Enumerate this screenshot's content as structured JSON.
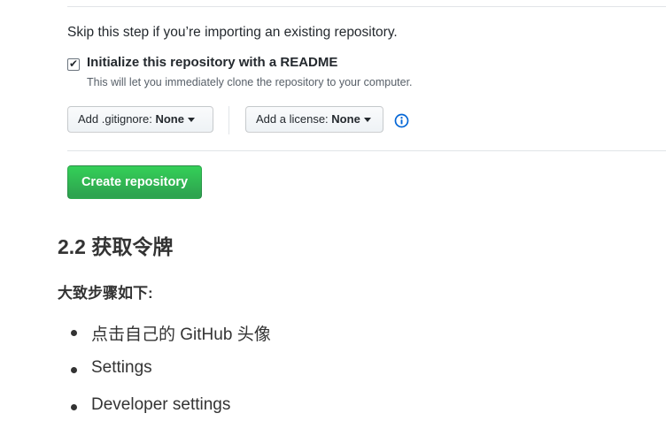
{
  "form": {
    "skip_text": "Skip this step if you’re importing an existing repository.",
    "readme": {
      "checked": true,
      "label": "Initialize this repository with a README",
      "description": "This will let you immediately clone the repository to your computer."
    },
    "gitignore": {
      "prefix": "Add .gitignore:",
      "value": "None"
    },
    "license": {
      "prefix": "Add a license:",
      "value": "None"
    },
    "info_icon": "info-circle-icon",
    "create_button": "Create repository",
    "colors": {
      "create_button": "#2ea44f",
      "info_icon": "#0366d6"
    }
  },
  "doc": {
    "heading": "2.2 获取令牌",
    "subheading": "大致步骤如下:",
    "steps": [
      "点击自己的 GitHub 头像",
      "Settings",
      "Developer settings"
    ]
  }
}
